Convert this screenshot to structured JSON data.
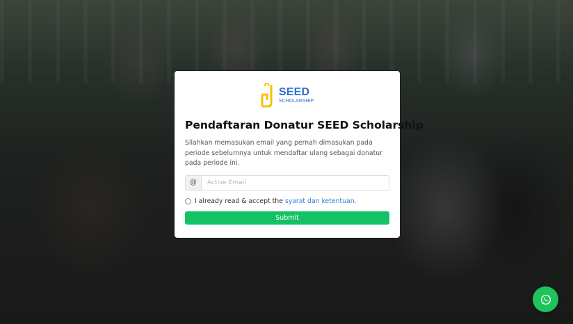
{
  "logo": {
    "brand": "SEED",
    "sub": "SCHOLARSHIP",
    "icon": "seed-logo-icon",
    "brand_color": "#2f6fd0",
    "mark_color": "#f4c20d"
  },
  "form": {
    "title": "Pendaftaran Donatur SEED Scholarship",
    "description": "Silahkan memasukan email yang pernah dimasukan pada periode sebelumnya untuk mendaftar ulang sebagai donatur pada periode ini.",
    "email_addon": "@",
    "email_placeholder": "Active Email",
    "email_value": "",
    "agree_text": "I already read & accept the",
    "agree_link": "syarat dan ketentuan.",
    "submit_label": "Submit",
    "submit_color": "#13c265"
  },
  "whatsapp": {
    "icon": "whatsapp-icon",
    "color": "#1fc35b"
  }
}
